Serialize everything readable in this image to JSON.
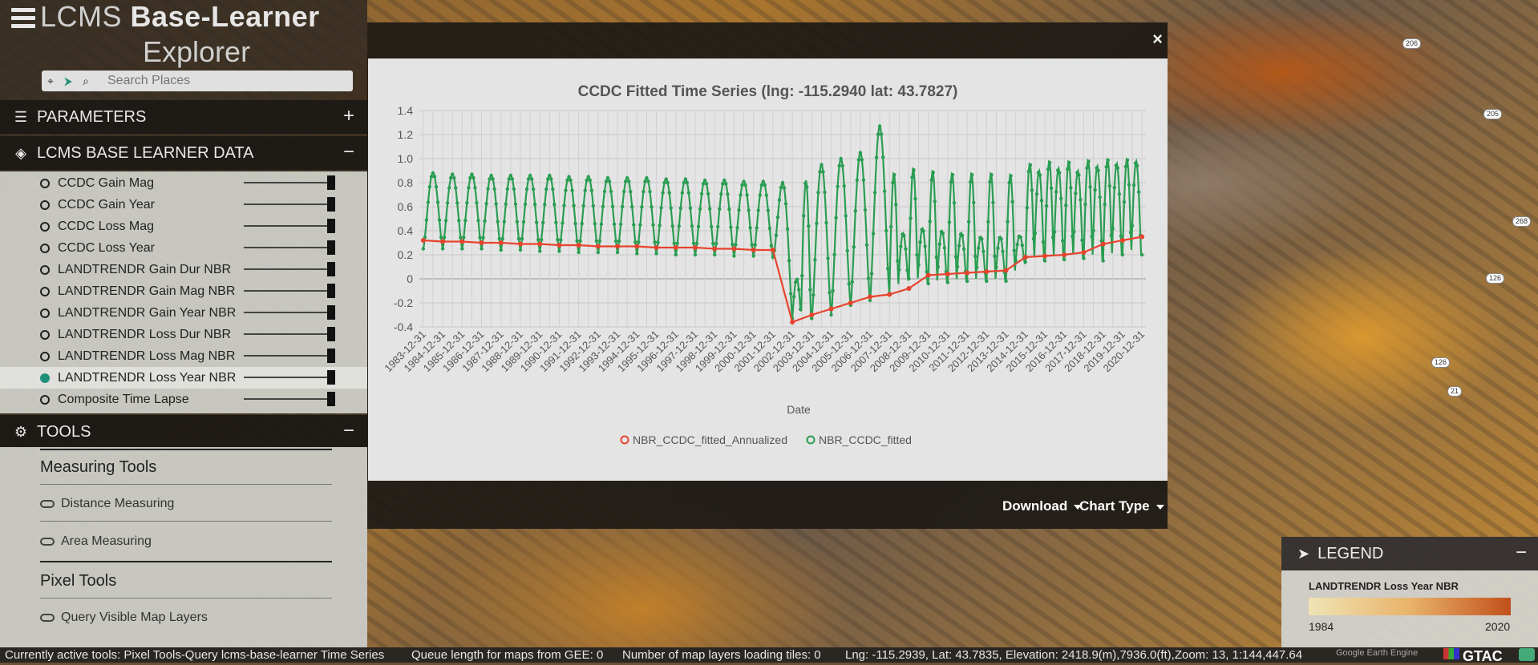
{
  "app": {
    "title_light": "LCMS",
    "title_bold": "Base-Learner",
    "subtitle": "Explorer",
    "search_placeholder": "Search Places"
  },
  "sections": {
    "parameters": "PARAMETERS",
    "data": "LCMS BASE LEARNER DATA",
    "tools": "TOOLS"
  },
  "layers": [
    {
      "label": "CCDC Gain Mag",
      "active": false
    },
    {
      "label": "CCDC Gain Year",
      "active": false
    },
    {
      "label": "CCDC Loss Mag",
      "active": false
    },
    {
      "label": "CCDC Loss Year",
      "active": false
    },
    {
      "label": "LANDTRENDR Gain Dur NBR",
      "active": false
    },
    {
      "label": "LANDTRENDR Gain Mag NBR",
      "active": false
    },
    {
      "label": "LANDTRENDR Gain Year NBR",
      "active": false
    },
    {
      "label": "LANDTRENDR Loss Dur NBR",
      "active": false
    },
    {
      "label": "LANDTRENDR Loss Mag NBR",
      "active": false
    },
    {
      "label": "LANDTRENDR Loss Year NBR",
      "active": true
    },
    {
      "label": "Composite Time Lapse",
      "active": false
    }
  ],
  "tools": {
    "measuring_header": "Measuring Tools",
    "distance": "Distance Measuring",
    "area": "Area Measuring",
    "pixel_header": "Pixel Tools",
    "query": "Query Visible Map Layers"
  },
  "modal": {
    "close": "×",
    "download": "Download",
    "chart_type": "Chart Type"
  },
  "road_labels": [
    "206",
    "205",
    "268",
    "126",
    "126",
    "21"
  ],
  "legend": {
    "header": "LEGEND",
    "layer": "LANDTRENDR Loss Year NBR",
    "min": "1984",
    "max": "2020",
    "colors": [
      "#efe4b5",
      "#e8b36a",
      "#c2501b"
    ]
  },
  "status": {
    "active_tools": "Currently active tools: Pixel Tools-Query lcms-base-learner Time Series",
    "queue": "Queue length for maps from GEE: 0",
    "loading": "Number of map layers loading tiles: 0",
    "coords": "Lng: -115.2939, Lat: 43.7835, Elevation: 2418.9(m),7936.0(ft),Zoom: 13, 1:144,447.64",
    "google": "Google Earth Engine",
    "gtac": "GTAC"
  },
  "chart_data": {
    "type": "line",
    "title": "CCDC Fitted Time Series (lng: -115.2940 lat: 43.7827)",
    "xlabel": "Date",
    "ylabel": "",
    "ylim": [
      -0.4,
      1.4
    ],
    "yticks": [
      -0.4,
      -0.2,
      0,
      0.2,
      0.4,
      0.6,
      0.8,
      1.0,
      1.2,
      1.4
    ],
    "ytick_labels": [
      "-0.4",
      "-0.2",
      "0",
      "0.2",
      "0.4",
      "0.6",
      "0.8",
      "1.0",
      "1.2",
      "1.4"
    ],
    "xlim_years": [
      1983.8,
      2021.2
    ],
    "categories": [
      "1983-12-31",
      "1984-12-31",
      "1985-12-31",
      "1986-12-31",
      "1987-12-31",
      "1988-12-31",
      "1989-12-31",
      "1990-12-31",
      "1991-12-31",
      "1992-12-31",
      "1993-12-31",
      "1994-12-31",
      "1995-12-31",
      "1996-12-31",
      "1997-12-31",
      "1998-12-31",
      "1999-12-31",
      "2000-12-31",
      "2001-12-31",
      "2002-12-31",
      "2003-12-31",
      "2004-12-31",
      "2005-12-31",
      "2006-12-31",
      "2007-12-31",
      "2008-12-31",
      "2009-12-31",
      "2010-12-31",
      "2011-12-31",
      "2012-12-31",
      "2013-12-31",
      "2014-12-31",
      "2015-12-31",
      "2016-12-31",
      "2017-12-31",
      "2018-12-31",
      "2019-12-31",
      "2020-12-31"
    ],
    "legend_position": "bottom",
    "grid": true,
    "series": [
      {
        "name": "NBR_CCDC_fitted_Annualized",
        "color": "#e8432e",
        "x": [
          1984.0,
          1985.0,
          1986.0,
          1987.0,
          1988.0,
          1989.0,
          1990.0,
          1991.0,
          1992.0,
          1993.0,
          1994.0,
          1995.0,
          1996.0,
          1997.0,
          1998.0,
          1999.0,
          2000.0,
          2001.0,
          2002.0,
          2003.0,
          2004.0,
          2005.0,
          2006.0,
          2007.0,
          2008.0,
          2009.0,
          2010.0,
          2011.0,
          2012.0,
          2013.0,
          2014.0,
          2015.0,
          2016.0,
          2017.0,
          2018.0,
          2019.0,
          2020.0,
          2021.0
        ],
        "y": [
          0.32,
          0.31,
          0.31,
          0.3,
          0.3,
          0.29,
          0.29,
          0.28,
          0.28,
          0.27,
          0.27,
          0.27,
          0.26,
          0.26,
          0.26,
          0.25,
          0.25,
          0.24,
          0.24,
          -0.36,
          -0.3,
          -0.25,
          -0.2,
          -0.15,
          -0.13,
          -0.08,
          0.03,
          0.04,
          0.05,
          0.06,
          0.07,
          0.18,
          0.19,
          0.2,
          0.22,
          0.29,
          0.32,
          0.35
        ]
      },
      {
        "name": "NBR_CCDC_fitted",
        "color": "#2a9d52",
        "peaks": [
          0.88,
          0.87,
          0.87,
          0.86,
          0.86,
          0.86,
          0.86,
          0.85,
          0.85,
          0.84,
          0.84,
          0.84,
          0.83,
          0.83,
          0.82,
          0.82,
          0.81,
          0.81,
          0.8,
          0.0,
          0.95,
          1.0,
          1.05,
          1.27,
          0.88,
          0.92,
          0.9,
          0.88,
          0.88,
          0.88,
          0.87,
          0.96,
          0.98,
          0.98,
          0.99,
          1.0,
          1.0
        ],
        "troughs": [
          0.25,
          0.25,
          0.25,
          0.25,
          0.24,
          0.24,
          0.23,
          0.23,
          0.22,
          0.22,
          0.22,
          0.21,
          0.21,
          0.2,
          0.2,
          0.2,
          0.19,
          0.19,
          0.18,
          -0.33,
          -0.33,
          -0.3,
          -0.22,
          -0.18,
          -0.12,
          0.0,
          -0.04,
          -0.03,
          -0.02,
          -0.02,
          -0.02,
          0.14,
          0.15,
          0.16,
          0.17,
          0.15,
          0.2
        ],
        "second_peaks": [
          null,
          null,
          null,
          null,
          null,
          null,
          null,
          null,
          null,
          null,
          null,
          null,
          null,
          null,
          null,
          null,
          null,
          null,
          null,
          0.82,
          null,
          null,
          null,
          null,
          0.38,
          0.42,
          0.4,
          0.38,
          0.35,
          0.35,
          0.36,
          0.9,
          0.92,
          0.9,
          0.94,
          0.96,
          0.98
        ]
      }
    ]
  }
}
